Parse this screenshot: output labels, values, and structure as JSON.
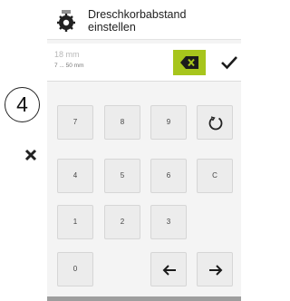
{
  "header": {
    "title_line1": "Dreschkorbabstand",
    "title_line2": "einstellen",
    "icon": "concave-gear-icon"
  },
  "input": {
    "value": "18 mm",
    "range": "7 ... 50 mm",
    "backspace_icon": "backspace-icon",
    "confirm_icon": "checkmark-icon",
    "accent_color": "#a7c51c"
  },
  "step_badge": "4",
  "close_icon": "close-icon",
  "keypad": {
    "k7": "7",
    "k8": "8",
    "k9": "9",
    "k4": "4",
    "k5": "5",
    "k6": "6",
    "clear": "C",
    "k1": "1",
    "k2": "2",
    "k3": "3",
    "k0": "0",
    "reset_icon": "reset-circle-icon",
    "left_icon": "arrow-left-icon",
    "right_icon": "arrow-right-icon"
  }
}
